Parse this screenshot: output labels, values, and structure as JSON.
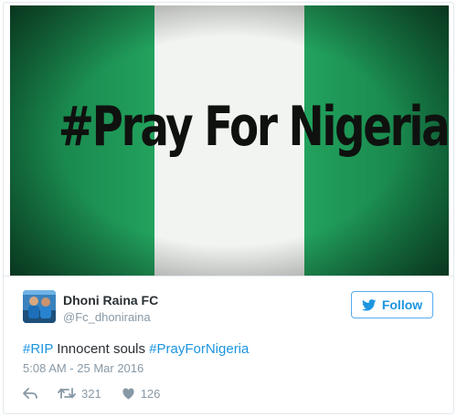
{
  "media": {
    "image_text": "#Pray For Nigeria",
    "colors": {
      "green": "#1f8f53",
      "white": "#f4f6f3",
      "text": "#0f110f"
    }
  },
  "tweet": {
    "author": {
      "name": "Dhoni Raina FC",
      "handle": "@Fc_dhoniraina",
      "avatar_icon": "avatar-image"
    },
    "follow_label": "Follow",
    "text_parts": [
      {
        "type": "hashtag",
        "text": "#RIP"
      },
      {
        "type": "text",
        "text": " Innocent souls "
      },
      {
        "type": "hashtag",
        "text": "#PrayForNigeria"
      }
    ],
    "timestamp": "5:08 AM - 25 Mar 2016",
    "actions": {
      "reply_icon": "reply-icon",
      "retweet_icon": "retweet-icon",
      "retweet_count": "321",
      "like_icon": "heart-icon",
      "like_count": "126"
    }
  },
  "colors": {
    "accent": "#1b95e0",
    "name": "#292f33",
    "muted": "#8899a6",
    "border": "#e1e8ed"
  }
}
